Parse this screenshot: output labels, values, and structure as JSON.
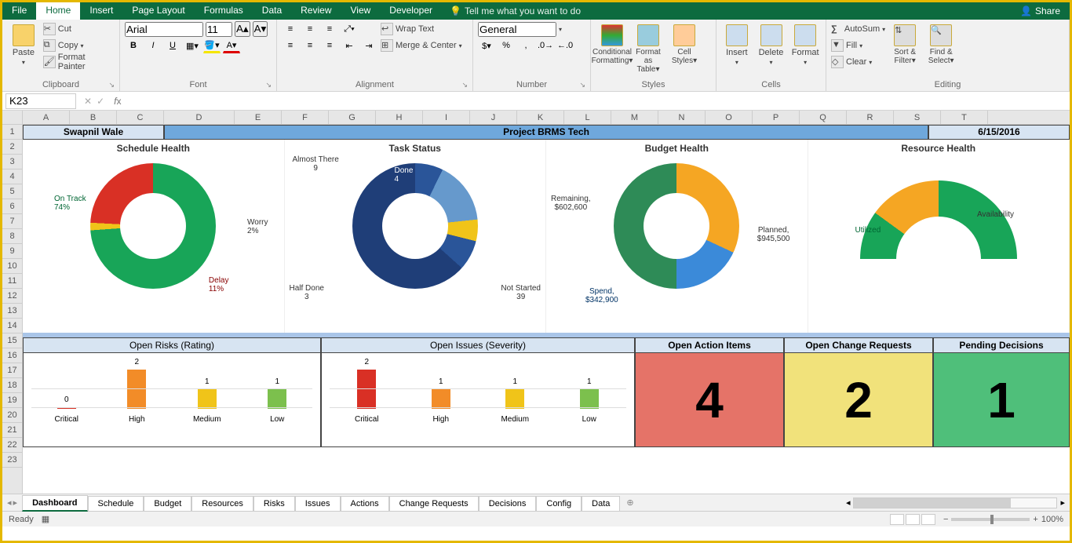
{
  "menu": {
    "tabs": [
      "File",
      "Home",
      "Insert",
      "Page Layout",
      "Formulas",
      "Data",
      "Review",
      "View",
      "Developer"
    ],
    "active": 1,
    "tellme": "Tell me what you want to do",
    "share": "Share"
  },
  "ribbon": {
    "clipboard": {
      "paste": "Paste",
      "cut": "Cut",
      "copy": "Copy",
      "painter": "Format Painter",
      "label": "Clipboard"
    },
    "font": {
      "name": "Arial",
      "size": "11",
      "label": "Font"
    },
    "alignment": {
      "wrap": "Wrap Text",
      "merge": "Merge & Center",
      "label": "Alignment"
    },
    "number": {
      "format": "General",
      "label": "Number"
    },
    "styles": {
      "cond": "Conditional Formatting",
      "table": "Format as Table",
      "cell": "Cell Styles",
      "label": "Styles"
    },
    "cells": {
      "insert": "Insert",
      "delete": "Delete",
      "format": "Format",
      "label": "Cells"
    },
    "editing": {
      "sum": "AutoSum",
      "fill": "Fill",
      "clear": "Clear",
      "sort": "Sort & Filter",
      "find": "Find & Select",
      "label": "Editing"
    }
  },
  "fbar": {
    "namebox": "K23",
    "formula": ""
  },
  "cols": [
    "A",
    "B",
    "C",
    "D",
    "E",
    "F",
    "G",
    "H",
    "I",
    "J",
    "K",
    "L",
    "M",
    "N",
    "O",
    "P",
    "Q",
    "R",
    "S",
    "T"
  ],
  "rows": [
    "1",
    "2",
    "3",
    "4",
    "5",
    "6",
    "7",
    "8",
    "9",
    "10",
    "11",
    "12",
    "13",
    "14",
    "15",
    "16",
    "17",
    "18",
    "19",
    "20",
    "21",
    "22",
    "23"
  ],
  "dash": {
    "author": "Swapnil Wale",
    "title": "Project BRMS Tech",
    "date": "6/15/2016",
    "schedule": {
      "title": "Schedule Health",
      "ontrack_lbl": "On Track",
      "ontrack_pct": "74%",
      "worry_lbl": "Worry",
      "worry_pct": "2%",
      "delay_lbl": "Delay",
      "delay_pct": "11%"
    },
    "task": {
      "title": "Task Status",
      "done_lbl": "Done",
      "done_n": "4",
      "almost_lbl": "Almost There",
      "almost_n": "9",
      "half_lbl": "Half Done",
      "half_n": "3",
      "ns_lbl": "Not Started",
      "ns_n": "39"
    },
    "budget": {
      "title": "Budget Health",
      "remain_lbl": "Remaining,",
      "remain_v": "$602,600",
      "plan_lbl": "Planned,",
      "plan_v": "$945,500",
      "spend_lbl": "Spend,",
      "spend_v": "$342,900"
    },
    "resource": {
      "title": "Resource Health",
      "avail": "Availability",
      "util": "Utilized"
    },
    "risks": {
      "title": "Open Risks",
      "sub": "(Rating)"
    },
    "issues": {
      "title": "Open Issues",
      "sub": "(Severity)"
    },
    "bar_cats": [
      "Critical",
      "High",
      "Medium",
      "Low"
    ],
    "risk_vals": [
      "0",
      "2",
      "1",
      "1"
    ],
    "issue_vals": [
      "2",
      "1",
      "1",
      "1"
    ],
    "kpi1": {
      "title": "Open Action Items",
      "val": "4"
    },
    "kpi2": {
      "title": "Open Change Requests",
      "val": "2"
    },
    "kpi3": {
      "title": "Pending Decisions",
      "val": "1"
    }
  },
  "sheets": [
    "Dashboard",
    "Schedule",
    "Budget",
    "Resources",
    "Risks",
    "Issues",
    "Actions",
    "Change Requests",
    "Decisions",
    "Config",
    "Data"
  ],
  "status": {
    "ready": "Ready",
    "zoom": "100%"
  },
  "chart_data": [
    {
      "type": "pie",
      "title": "Schedule Health",
      "series": [
        {
          "name": "On Track",
          "value": 74
        },
        {
          "name": "Worry",
          "value": 2
        },
        {
          "name": "Delay",
          "value": 11
        }
      ]
    },
    {
      "type": "pie",
      "title": "Task Status",
      "series": [
        {
          "name": "Done",
          "value": 4
        },
        {
          "name": "Almost There",
          "value": 9
        },
        {
          "name": "Half Done",
          "value": 3
        },
        {
          "name": "Not Started",
          "value": 39
        }
      ]
    },
    {
      "type": "pie",
      "title": "Budget Health",
      "series": [
        {
          "name": "Remaining",
          "value": 602600
        },
        {
          "name": "Spend",
          "value": 342900
        },
        {
          "name": "Planned",
          "value": 945500
        }
      ]
    },
    {
      "type": "pie",
      "title": "Resource Health",
      "series": [
        {
          "name": "Utilized",
          "value": 20
        },
        {
          "name": "Availability",
          "value": 80
        }
      ]
    },
    {
      "type": "bar",
      "title": "Open Risks (Rating)",
      "categories": [
        "Critical",
        "High",
        "Medium",
        "Low"
      ],
      "values": [
        0,
        2,
        1,
        1
      ],
      "ylim": [
        0,
        2
      ]
    },
    {
      "type": "bar",
      "title": "Open Issues (Severity)",
      "categories": [
        "Critical",
        "High",
        "Medium",
        "Low"
      ],
      "values": [
        2,
        1,
        1,
        1
      ],
      "ylim": [
        0,
        2
      ]
    }
  ]
}
